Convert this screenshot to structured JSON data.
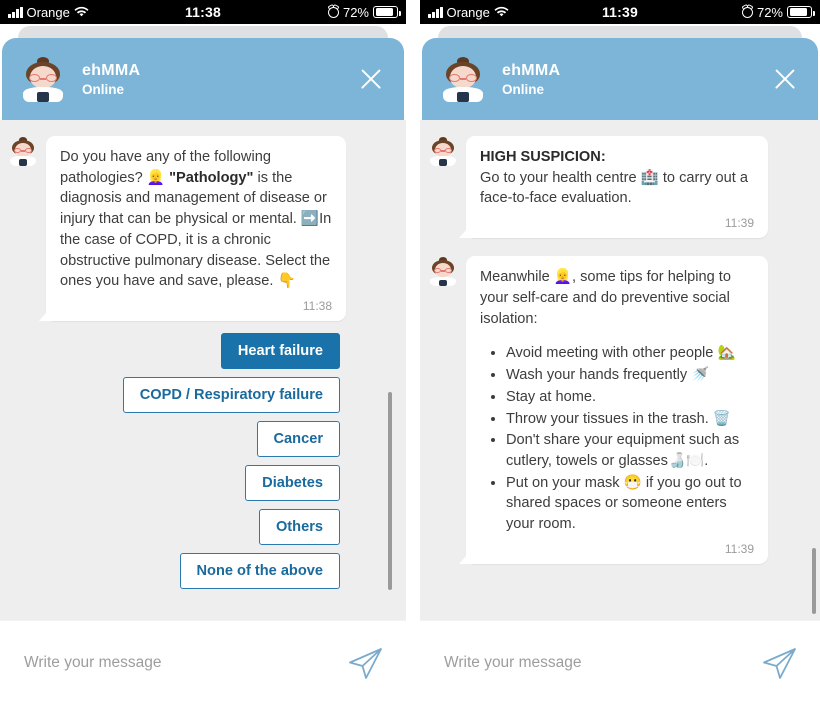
{
  "panels": [
    {
      "statusbar": {
        "carrier": "Orange",
        "time": "11:38",
        "battery_pct": "72%",
        "signal_icon": "signal-bars-icon",
        "wifi_icon": "wifi-icon",
        "alarm_icon": "alarm-clock-icon",
        "battery_icon": "battery-icon"
      },
      "header": {
        "name": "ehMMA",
        "status": "Online",
        "avatar_icon": "doctor-avatar",
        "close_icon": "close-icon"
      },
      "messages": [
        {
          "text_html": "Do you have any of the following pathologies? 👱‍♀️ <b>\"Pathology\"</b> is the diagnosis and management of disease or injury that can be physical or mental. ➡️In the case of COPD, it is a chronic obstructive pulmonary disease. Select the ones you have and save, please. 👇",
          "time": "11:38"
        }
      ],
      "quick_replies": [
        {
          "label": "Heart failure",
          "selected": true
        },
        {
          "label": "COPD / Respiratory failure",
          "selected": false
        },
        {
          "label": "Cancer",
          "selected": false
        },
        {
          "label": "Diabetes",
          "selected": false
        },
        {
          "label": "Others",
          "selected": false
        },
        {
          "label": "None of the above",
          "selected": false
        }
      ],
      "input": {
        "placeholder": "Write your message",
        "send_icon": "send-paper-plane-icon"
      }
    },
    {
      "statusbar": {
        "carrier": "Orange",
        "time": "11:39",
        "battery_pct": "72%",
        "signal_icon": "signal-bars-icon",
        "wifi_icon": "wifi-icon",
        "alarm_icon": "alarm-clock-icon",
        "battery_icon": "battery-icon"
      },
      "header": {
        "name": "ehMMA",
        "status": "Online",
        "avatar_icon": "doctor-avatar",
        "close_icon": "close-icon"
      },
      "messages": [
        {
          "text_html": "<b>HIGH SUSPICION:</b><br>Go to your health centre 🏥 to carry out a face-to-face evaluation.",
          "time": "11:39"
        },
        {
          "text_html": "Meanwhile 👱‍♀️, some tips for helping to your self-care and do preventive social isolation:<ul><li>Avoid meeting with other people 🏡</li><li>Wash your hands frequently 🚿</li><li>Stay at home.</li><li>Throw your tissues in the trash. 🗑️</li><li>Don't share your equipment such as cutlery, towels or glasses🍶🍽️.</li><li>Put on your mask 😷 if you go out to shared spaces or someone enters your room.</li></ul>",
          "time": "11:39"
        }
      ],
      "quick_replies": [],
      "input": {
        "placeholder": "Write your message",
        "send_icon": "send-paper-plane-icon"
      }
    }
  ],
  "colors": {
    "header_blue": "#7db5d8",
    "accent_blue": "#1a72ab",
    "chat_bg": "#eeeeee",
    "bubble_bg": "#ffffff"
  }
}
